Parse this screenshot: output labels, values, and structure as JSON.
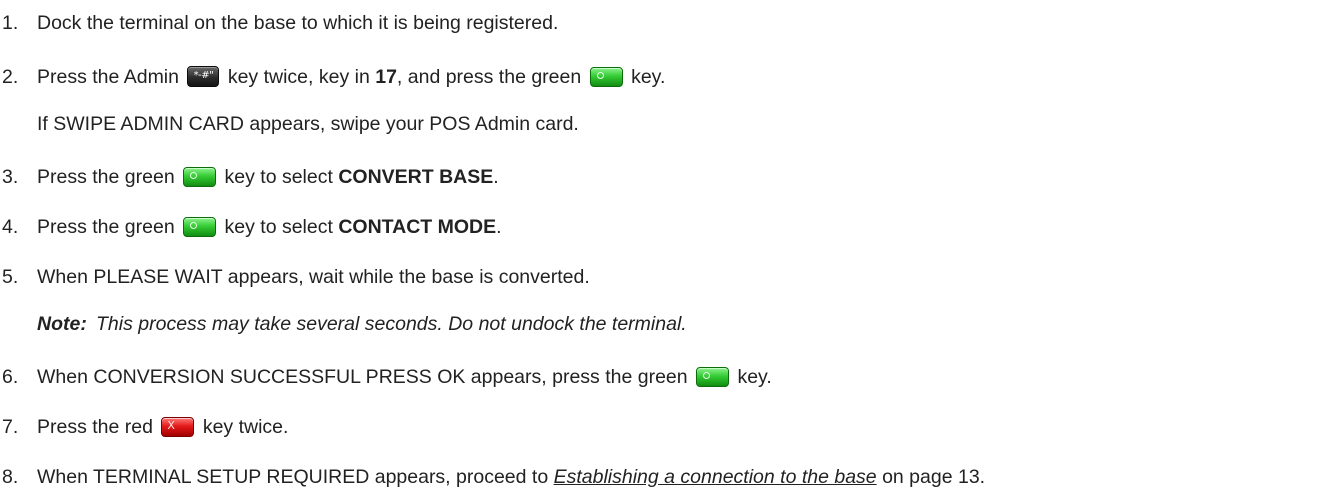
{
  "steps": [
    {
      "num": "1.",
      "text": "Dock the terminal on the base to which it is being registered."
    },
    {
      "num": "2.",
      "a": "Press the Admin",
      "b": "key twice, key in",
      "bold": "17",
      "c": ", and press the green",
      "d": "key.",
      "continuation": "If SWIPE ADMIN CARD appears, swipe your POS Admin card."
    },
    {
      "num": "3.",
      "a": "Press the green",
      "b": "key to select",
      "bold": "CONVERT BASE",
      "end": "."
    },
    {
      "num": "4.",
      "a": "Press the green",
      "b": "key to select",
      "bold": "CONTACT MODE",
      "end": "."
    },
    {
      "num": "5.",
      "text": "When PLEASE WAIT appears, wait while the base is converted.",
      "note_label": "Note:",
      "note_text": "This process may take several seconds.  Do not undock the terminal."
    },
    {
      "num": "6.",
      "a": "When CONVERSION SUCCESSFUL PRESS OK appears, press the green",
      "b": "key."
    },
    {
      "num": "7.",
      "a": "Press the red",
      "b": "key twice."
    },
    {
      "num": "8.",
      "a": "When TERMINAL SETUP REQUIRED appears, proceed to",
      "link": "Establishing a connection to the base",
      "b": "on page 13."
    }
  ],
  "icons": {
    "admin_key": "admin-key-icon",
    "green_key": "green-ok-key-icon",
    "red_key": "red-cancel-key-icon",
    "admin_glyph": "*-#\"",
    "red_glyph": "X"
  },
  "colors": {
    "text": "#222222",
    "green_key": "#34cc34",
    "red_key": "#e41a1a",
    "admin_key": "#2c2c2c"
  }
}
